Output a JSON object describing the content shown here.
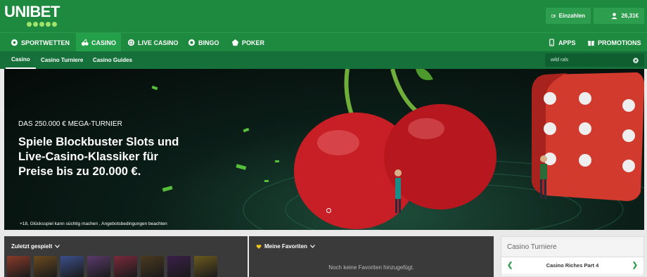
{
  "brand": {
    "name": "UNIBET"
  },
  "account": {
    "deposit_label": "Einzahlen",
    "balance": "26,31€"
  },
  "nav": {
    "left": [
      {
        "label": "SPORTWETTEN",
        "icon": "soccer-ball-icon"
      },
      {
        "label": "CASINO",
        "icon": "cherry-icon"
      },
      {
        "label": "LIVE CASINO",
        "icon": "chip-icon"
      },
      {
        "label": "BINGO",
        "icon": "bingo-ball-icon"
      },
      {
        "label": "POKER",
        "icon": "poker-icon"
      }
    ],
    "right": [
      {
        "label": "APPS",
        "icon": "mobile-icon"
      },
      {
        "label": "PROMOTIONS",
        "icon": "gift-icon"
      }
    ]
  },
  "subnav": {
    "items": [
      "Casino",
      "Casino Turniere",
      "Casino Guides"
    ]
  },
  "search": {
    "value": "wild rals"
  },
  "hero": {
    "kicker": "DAS 250.000 € MEGA-TURNIER",
    "title": "Spiele Blockbuster Slots und Live-Casino-Klassiker für Preise bis zu 20.000 €.",
    "disclaimer": "+18, Glücksspiel kann süchtig machen , Angebotsbedingungen beachten"
  },
  "recent": {
    "label": "Zuletzt gespielt",
    "thumb_colors": [
      "#8a3b2a",
      "#6b4a1f",
      "#3b4f8a",
      "#5a3a6b",
      "#7a2a3a",
      "#4a3a1f",
      "#3a1f4a",
      "#6b5a1f"
    ]
  },
  "favorites": {
    "label": "Meine Favoriten",
    "empty_text": "Noch keine Favoriten hinzugefügt."
  },
  "tournaments": {
    "title": "Casino Turniere",
    "current": "Casino Riches Part 4"
  }
}
